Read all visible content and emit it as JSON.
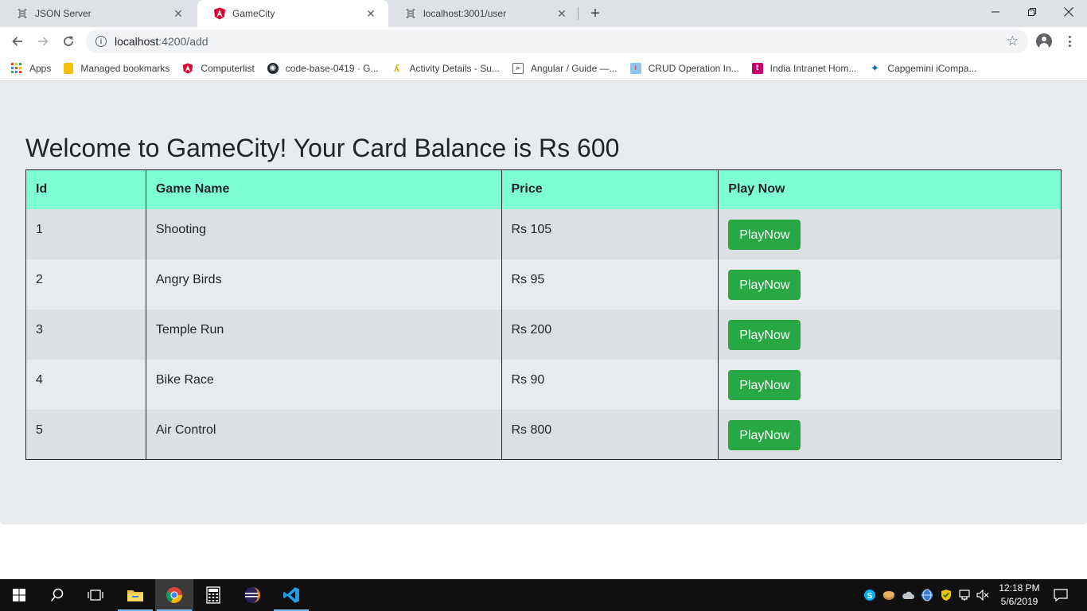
{
  "browser": {
    "tabs": [
      {
        "title": "JSON Server",
        "active": false
      },
      {
        "title": "GameCity",
        "active": true
      },
      {
        "title": "localhost:3001/user",
        "active": false
      }
    ],
    "address": {
      "host": "localhost",
      "path": ":4200/add"
    },
    "bookmarks": [
      {
        "label": "Apps",
        "icon": "apps-grid-icon"
      },
      {
        "label": "Managed bookmarks",
        "icon": "folder-icon"
      },
      {
        "label": "Computerlist",
        "icon": "angular-icon"
      },
      {
        "label": "code-base-0419 · G...",
        "icon": "github-icon"
      },
      {
        "label": "Activity Details - Su...",
        "icon": "activity-icon"
      },
      {
        "label": "Angular / Guide —...",
        "icon": "search-icon"
      },
      {
        "label": "CRUD Operation In...",
        "icon": "crud-icon"
      },
      {
        "label": "India Intranet Hom...",
        "icon": "intranet-icon"
      },
      {
        "label": "Capgemini iCompa...",
        "icon": "capgemini-icon"
      }
    ]
  },
  "page": {
    "heading": "Welcome to GameCity! Your Card Balance is Rs 600",
    "table": {
      "headers": [
        "Id",
        "Game Name",
        "Price",
        "Play Now"
      ],
      "rows": [
        {
          "id": "1",
          "name": "Shooting",
          "price": "Rs 105",
          "action": "PlayNow"
        },
        {
          "id": "2",
          "name": "Angry Birds",
          "price": "Rs 95",
          "action": "PlayNow"
        },
        {
          "id": "3",
          "name": "Temple Run",
          "price": "Rs 200",
          "action": "PlayNow"
        },
        {
          "id": "4",
          "name": "Bike Race",
          "price": "Rs 90",
          "action": "PlayNow"
        },
        {
          "id": "5",
          "name": "Air Control",
          "price": "Rs 800",
          "action": "PlayNow"
        }
      ]
    },
    "colors": {
      "header_bg": "#7fffd4",
      "button_bg": "#28a745",
      "page_bg": "#e9ecef"
    }
  },
  "taskbar": {
    "clock_time": "12:18 PM",
    "clock_date": "5/6/2019",
    "apps": [
      "start-icon",
      "search-icon",
      "task-view-icon",
      "file-explorer-icon",
      "chrome-icon",
      "calculator-icon",
      "eclipse-icon",
      "vscode-icon"
    ]
  }
}
